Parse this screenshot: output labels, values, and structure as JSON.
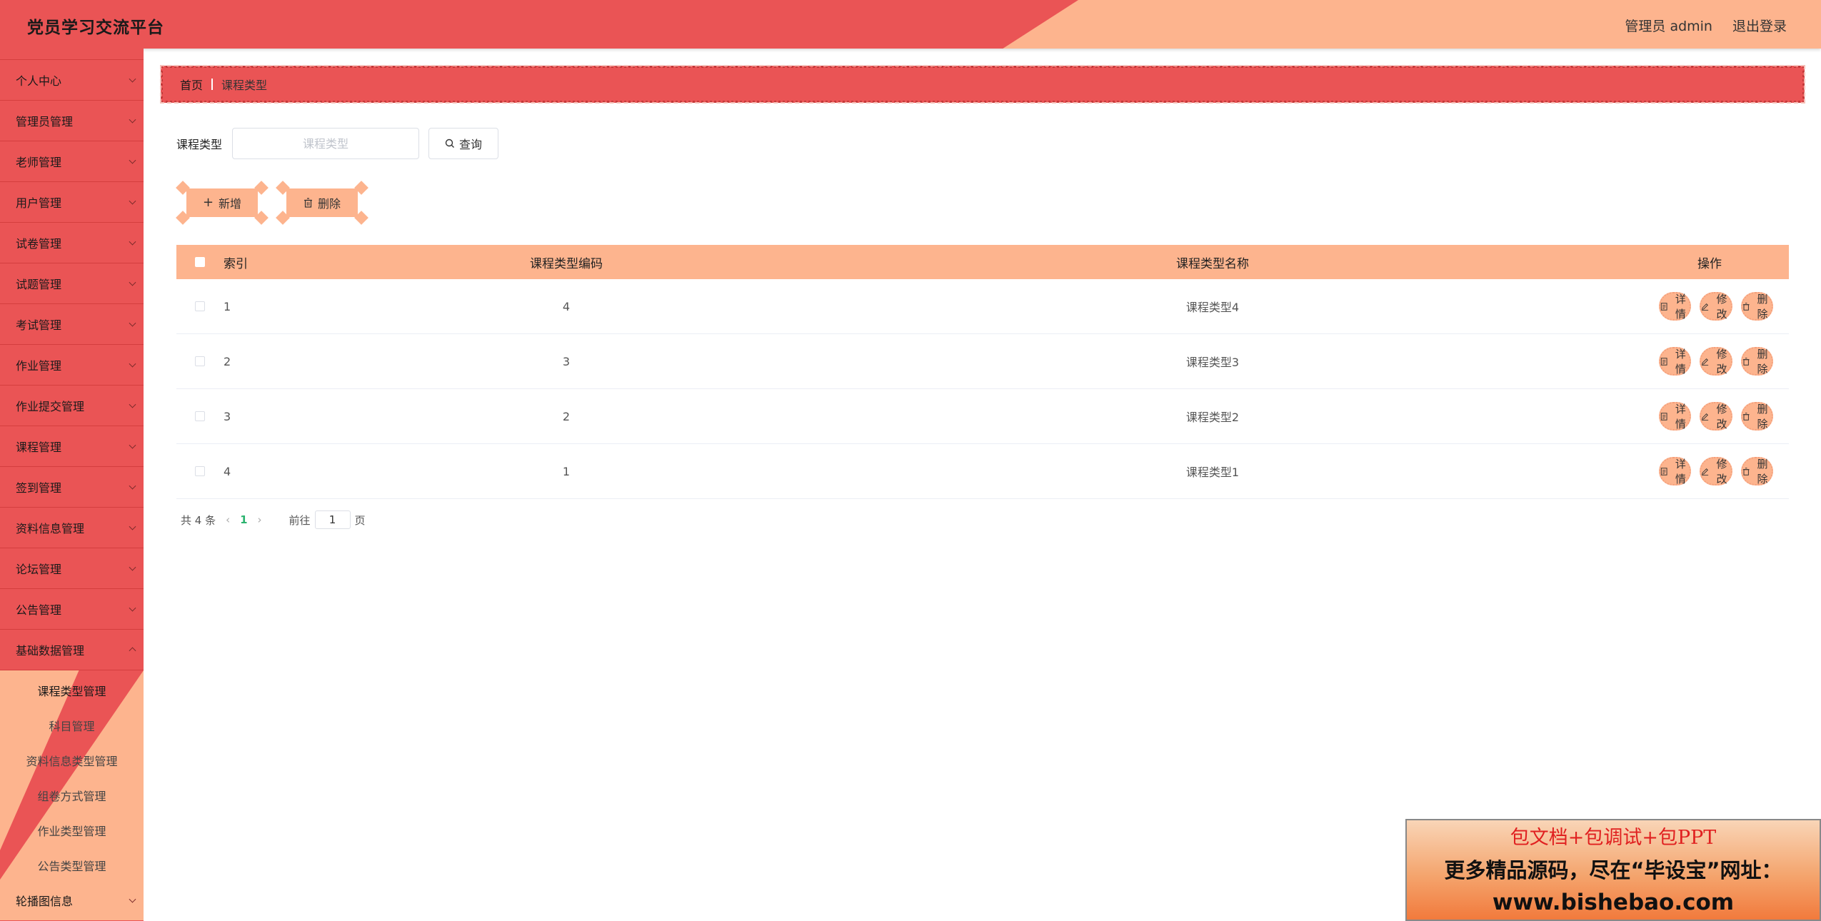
{
  "header": {
    "title": "党员学习交流平台",
    "user": "管理员 admin",
    "logout": "退出登录"
  },
  "sidebar": {
    "items": [
      {
        "label": "个人中心"
      },
      {
        "label": "管理员管理"
      },
      {
        "label": "老师管理"
      },
      {
        "label": "用户管理"
      },
      {
        "label": "试卷管理"
      },
      {
        "label": "试题管理"
      },
      {
        "label": "考试管理"
      },
      {
        "label": "作业管理"
      },
      {
        "label": "作业提交管理"
      },
      {
        "label": "课程管理"
      },
      {
        "label": "签到管理"
      },
      {
        "label": "资料信息管理"
      },
      {
        "label": "论坛管理"
      },
      {
        "label": "公告管理"
      },
      {
        "label": "基础数据管理"
      }
    ],
    "submenu": [
      {
        "label": "课程类型管理"
      },
      {
        "label": "科目管理"
      },
      {
        "label": "资料信息类型管理"
      },
      {
        "label": "组卷方式管理"
      },
      {
        "label": "作业类型管理"
      },
      {
        "label": "公告类型管理"
      }
    ],
    "bottom": {
      "label": "轮播图信息"
    }
  },
  "breadcrumb": {
    "home": "首页",
    "current": "课程类型"
  },
  "search": {
    "label": "课程类型",
    "placeholder": "课程类型",
    "button": "查询"
  },
  "actions": {
    "add": "新增",
    "delete": "删除"
  },
  "table": {
    "headers": {
      "index": "索引",
      "code": "课程类型编码",
      "name": "课程类型名称",
      "ops": "操作"
    },
    "rows": [
      {
        "index": "1",
        "code": "4",
        "name": "课程类型4"
      },
      {
        "index": "2",
        "code": "3",
        "name": "课程类型3"
      },
      {
        "index": "3",
        "code": "2",
        "name": "课程类型2"
      },
      {
        "index": "4",
        "code": "1",
        "name": "课程类型1"
      }
    ],
    "op_labels": {
      "detail": "详情",
      "edit": "修改",
      "delete": "删除"
    }
  },
  "pager": {
    "total": "共 4 条",
    "current_page": "1",
    "goto_label": "前往",
    "goto_value": "1",
    "page_suffix": "页"
  },
  "ad": {
    "line1": "包文档+包调试+包PPT",
    "line2": "更多精品源码，尽在“毕设宝”网址：",
    "line3": "www.bishebao.com"
  },
  "colors": {
    "primary_red": "#ea5455",
    "accent_peach": "#fdb48e",
    "page_active": "#2bb36f"
  }
}
